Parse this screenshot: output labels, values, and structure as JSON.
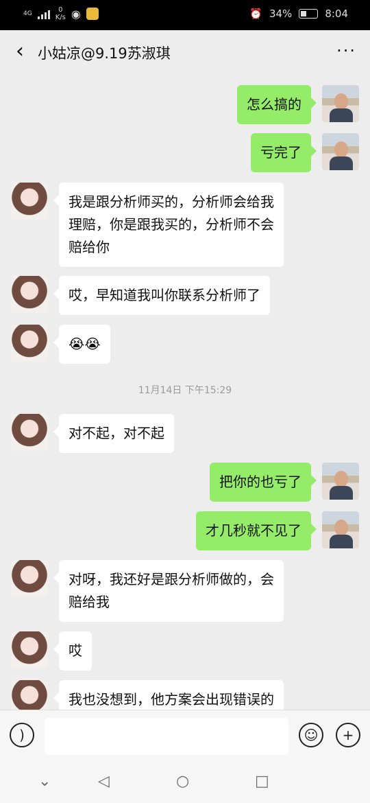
{
  "status_bar": {
    "network": "4G",
    "speed_value": "0",
    "speed_unit": "K/s",
    "battery": "34%",
    "time": "8:04"
  },
  "header": {
    "back_icon": "chevron-left-icon",
    "title": "小姑凉@9.19苏淑琪",
    "more_icon": "more-dots-icon"
  },
  "messages": [
    {
      "from": "me",
      "text": "怎么搞的"
    },
    {
      "from": "me",
      "text": "亏完了"
    },
    {
      "from": "her",
      "lines": [
        "我是跟分析师买的，分析师会给我",
        "理赔，你是跟我买的，分析师不会",
        "赔给你"
      ]
    },
    {
      "from": "her",
      "text": "哎，早知道我叫你联系分析师了"
    },
    {
      "from": "her",
      "text": "😭😭"
    },
    {
      "timestamp": "11月14日 下午15:29"
    },
    {
      "from": "her",
      "text": "对不起，对不起"
    },
    {
      "from": "me",
      "text": "把你的也亏了"
    },
    {
      "from": "me",
      "text": "才几秒就不见了"
    },
    {
      "from": "her",
      "lines": [
        "对呀，我还好是跟分析师做的，会",
        "赔给我"
      ]
    },
    {
      "from": "her",
      "text": "哎"
    },
    {
      "from": "her",
      "text": "我也没想到，他方案会出现错误的"
    }
  ],
  "input_bar": {
    "voice_icon": "voice-icon",
    "emoji_icon": "emoji-icon",
    "plus_icon": "plus-icon",
    "text_value": ""
  },
  "system_nav": {
    "collapse_icon": "chevron-down-icon",
    "back_icon": "triangle-back-icon",
    "home_icon": "circle-home-icon",
    "recent_icon": "square-recent-icon"
  },
  "colors": {
    "chat_bg": "#ededed",
    "my_bubble": "#95ec69",
    "her_bubble": "#ffffff",
    "status_bar": "#000000"
  }
}
